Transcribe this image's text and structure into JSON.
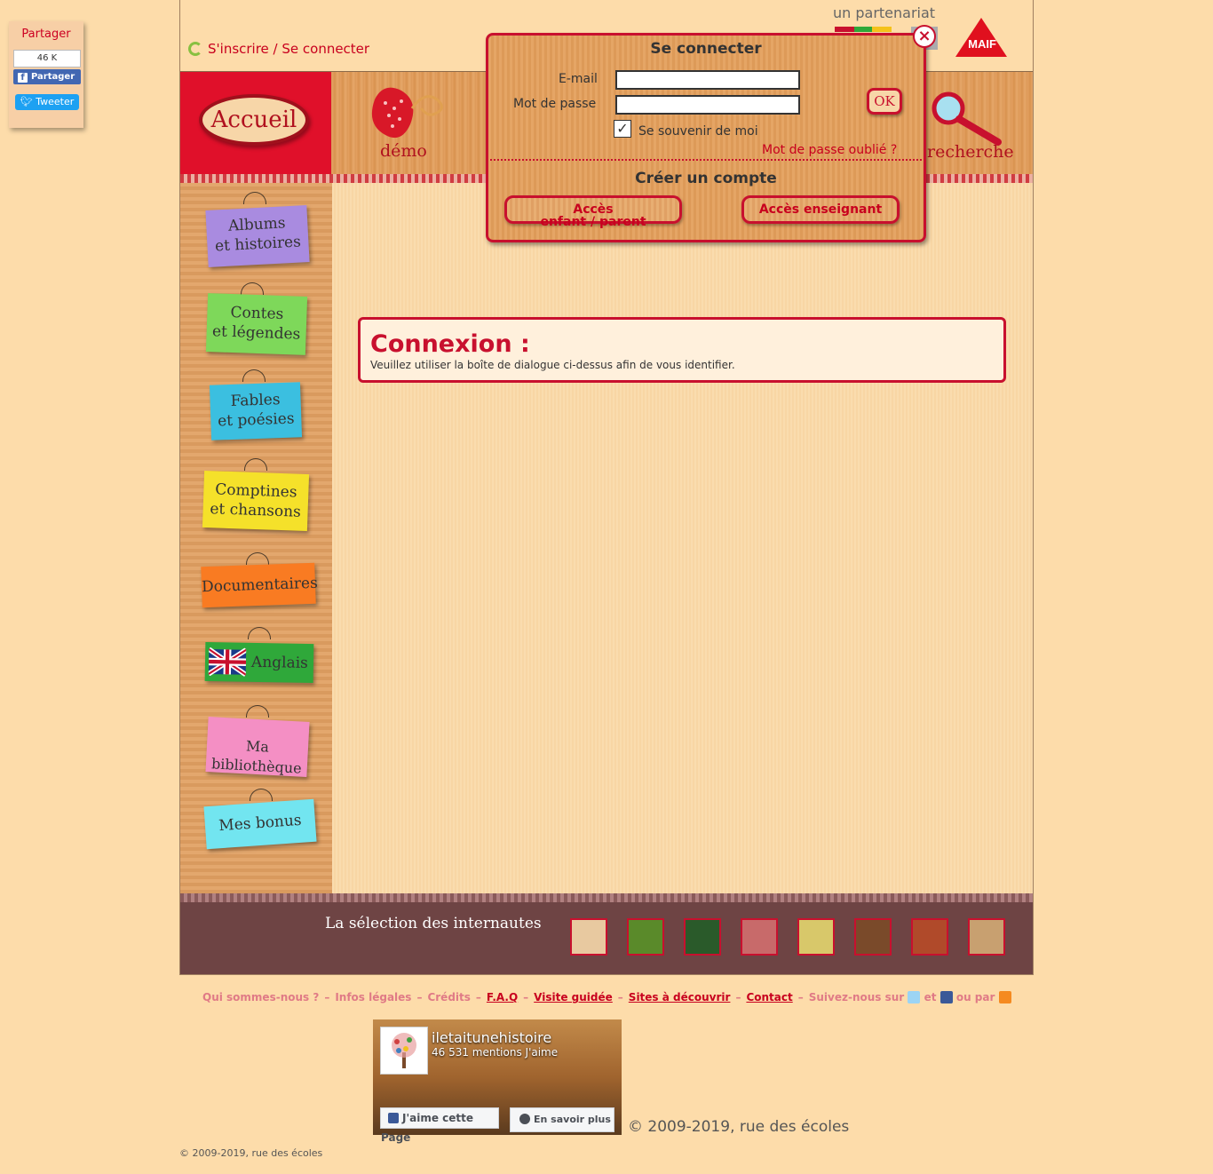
{
  "share": {
    "title": "Partager",
    "fb_count": "46 K",
    "fb_label": "Partager",
    "tweet_label": "Tweeter"
  },
  "header": {
    "login_link": "S'inscrire / Se connecter",
    "partner_label": "un partenariat",
    "maif_logo": "MAIF"
  },
  "nav": {
    "accueil": "Accueil",
    "demo": "démo",
    "search": "recherche"
  },
  "sidebar": {
    "items": [
      {
        "label1": "Albums",
        "label2": "et histoires",
        "color": "#a98be0"
      },
      {
        "label1": "Contes",
        "label2": "et légendes",
        "color": "#7ed85a"
      },
      {
        "label1": "Fables",
        "label2": "et poésies",
        "color": "#3bbfe0"
      },
      {
        "label1": "Comptines",
        "label2": "et chansons",
        "color": "#f5e12a"
      },
      {
        "label1": "Documentaires",
        "label2": "",
        "color": "#f97b22"
      },
      {
        "label1": "Anglais",
        "label2": "",
        "color": "#2fa83a"
      },
      {
        "label1": "Ma bibliothèque",
        "label2": "",
        "color": "#f48fc4"
      },
      {
        "label1": "Mes bonus",
        "label2": "",
        "color": "#72e5f0"
      }
    ]
  },
  "main": {
    "title": "Connexion :",
    "message": "Veuillez utiliser la boîte de dialogue ci-dessus afin de vous identifier."
  },
  "login_popup": {
    "title": "Se connecter",
    "email_label": "E-mail",
    "password_label": "Mot de passe",
    "ok_label": "OK",
    "remember_label": "Se souvenir de moi",
    "remember_checked": true,
    "forgot_label": "Mot de passe oublié ?",
    "create_title": "Créer un compte",
    "child_button": "Accès",
    "child_button_sub": "enfant / parent",
    "teacher_button": "Accès enseignant"
  },
  "selection": {
    "label": "La sélection des internautes",
    "thumbnails": [
      {
        "color": "#e8c9a0"
      },
      {
        "color": "#5a8a2a"
      },
      {
        "color": "#2a5a2a"
      },
      {
        "color": "#c86a6a"
      },
      {
        "color": "#d8c86a"
      },
      {
        "color": "#7a4a2a"
      },
      {
        "color": "#b04a2a"
      },
      {
        "color": "#c8a070"
      }
    ]
  },
  "footer": {
    "links": [
      {
        "label": "Qui sommes-nous ?",
        "style": "light"
      },
      {
        "label": "Infos légales",
        "style": "light"
      },
      {
        "label": "Crédits",
        "style": "light"
      },
      {
        "label": "F.A.Q",
        "style": "dark"
      },
      {
        "label": "Visite guidée",
        "style": "dark"
      },
      {
        "label": "Sites à découvrir",
        "style": "dark"
      },
      {
        "label": "Contact",
        "style": "dark"
      }
    ],
    "follow_label": "Suivez-nous sur",
    "and_label": "et",
    "or_label": "ou par",
    "fb_widget": {
      "page_name": "iletaitunehistoire",
      "likes": "46 531 mentions J'aime",
      "like_button": "J'aime cette Page",
      "more_button": "En savoir plus"
    },
    "copyright_large": "© 2009-2019, rue des écoles",
    "copyright_small": "© 2009-2019, rue des écoles"
  },
  "colors": {
    "brand_red": "#c8102e",
    "background": "#fddcaa"
  }
}
